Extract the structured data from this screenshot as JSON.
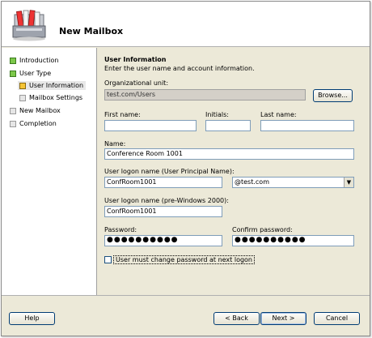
{
  "window": {
    "title": "New Mailbox",
    "icon": "mailbox-icon"
  },
  "nav": {
    "items": [
      {
        "label": "Introduction",
        "status": "complete"
      },
      {
        "label": "User Type",
        "status": "complete"
      },
      {
        "label": "User Information",
        "status": "current"
      },
      {
        "label": "Mailbox Settings",
        "status": "pending"
      },
      {
        "label": "New Mailbox",
        "status": "pending"
      },
      {
        "label": "Completion",
        "status": "pending"
      }
    ]
  },
  "form": {
    "section_title": "User Information",
    "description": "Enter the user name and account information.",
    "org_unit": {
      "label": "Organizational unit:",
      "value": "test.com/Users",
      "browse_label": "Browse..."
    },
    "first_name": {
      "label": "First name:",
      "value": ""
    },
    "initials": {
      "label": "Initials:",
      "value": ""
    },
    "last_name": {
      "label": "Last name:",
      "value": ""
    },
    "name": {
      "label": "Name:",
      "value": "Conference Room 1001"
    },
    "upn": {
      "label": "User logon name (User Principal Name):",
      "value": "ConfRoom1001",
      "domain": "@test.com"
    },
    "pre2000": {
      "label": "User logon name (pre-Windows 2000):",
      "value": "ConfRoom1001"
    },
    "password": {
      "label": "Password:",
      "value": "●●●●●●●●●●"
    },
    "confirm_password": {
      "label": "Confirm password:",
      "value": "●●●●●●●●●●"
    },
    "must_change": {
      "label": "User must change password at next logon",
      "checked": false
    }
  },
  "buttons": {
    "help": "Help",
    "back": "< Back",
    "next": "Next >",
    "cancel": "Cancel"
  },
  "colors": {
    "complete": "#7cc84a",
    "current": "#f6c535",
    "pending": "#e6e6e6"
  }
}
